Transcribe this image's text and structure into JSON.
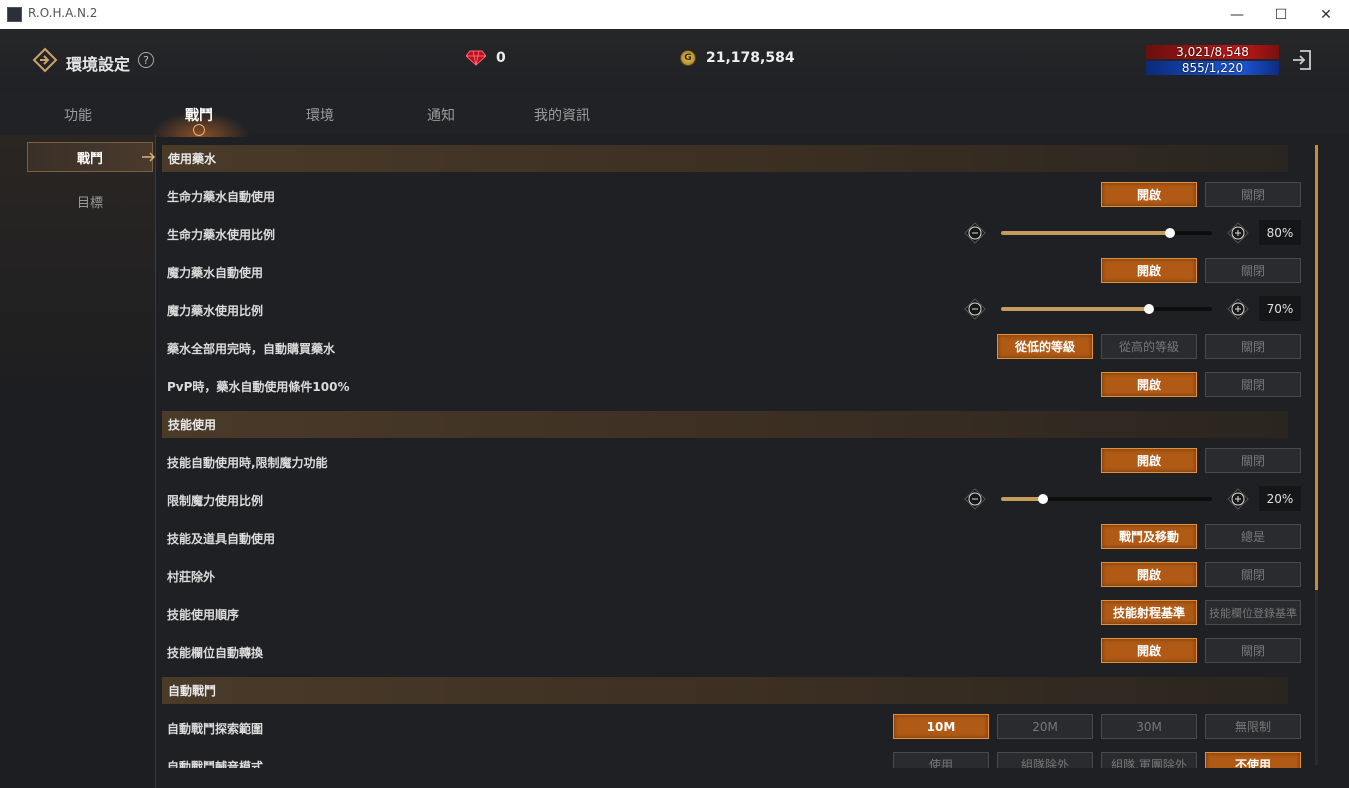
{
  "window": {
    "title": "R.O.H.A.N.2",
    "minimize": "—",
    "maximize": "☐",
    "close": "✕"
  },
  "header": {
    "title": "環境設定",
    "help": "?",
    "gems": "0",
    "gold": "21,178,584",
    "hp": "3,021/8,548",
    "mp": "855/1,220"
  },
  "tabs": [
    "功能",
    "戰鬥",
    "環境",
    "通知",
    "我的資訊"
  ],
  "sidebar": [
    "戰鬥",
    "目標"
  ],
  "sections": {
    "potion": "使用藥水",
    "skill": "技能使用",
    "auto": "自動戰鬥"
  },
  "rows": {
    "hp_auto": "生命力藥水自動使用",
    "hp_ratio": "生命力藥水使用比例",
    "mp_auto": "魔力藥水自動使用",
    "mp_ratio": "魔力藥水使用比例",
    "buy": "藥水全部用完時，自動購買藥水",
    "pvp": "PvP時，藥水自動使用條件100%",
    "skill_limit": "技能自動使用時,限制魔力功能",
    "limit_ratio": "限制魔力使用比例",
    "skill_item": "技能及道具自動使用",
    "village": "村莊除外",
    "order": "技能使用順序",
    "slot_switch": "技能欄位自動轉換",
    "range": "自動戰鬥探索範圍",
    "mode": "自動戰鬥輔音模式"
  },
  "labels": {
    "on": "開啟",
    "off": "關閉",
    "low": "從低的等級",
    "high": "從高的等級",
    "combat_move": "戰鬥及移動",
    "always": "總是",
    "range_basis": "技能射程基準",
    "slot_basis": "技能欄位登錄基準",
    "r10": "10M",
    "r20": "20M",
    "r30": "30M",
    "unlimited": "無限制",
    "use": "使用",
    "party_except": "組隊除外",
    "party_clan_except": "組隊.軍團除外",
    "not_use": "不使用"
  },
  "sliders": {
    "hp": {
      "value": 80,
      "text": "80%"
    },
    "mp": {
      "value": 70,
      "text": "70%"
    },
    "limit": {
      "value": 20,
      "text": "20%"
    }
  },
  "colors": {
    "accent": "#b05a16",
    "hp": "#c21818",
    "mp": "#1c58d8"
  },
  "icons": {
    "logo": "diamond-arrow-icon",
    "gem": "ruby-icon",
    "coin": "gold-coin-icon",
    "exit": "exit-icon",
    "minus": "minus-icon",
    "plus": "plus-icon",
    "arrow": "arrow-right-icon"
  }
}
